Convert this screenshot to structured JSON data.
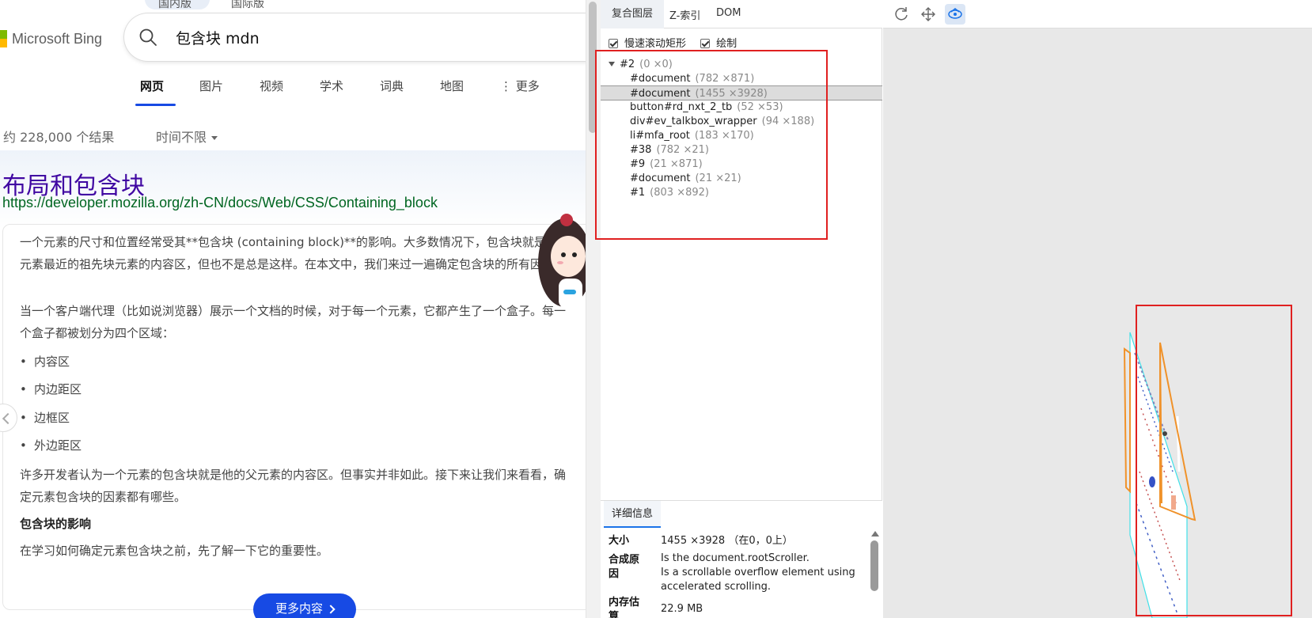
{
  "bing": {
    "top_tabs": [
      "国内版",
      "国际版"
    ],
    "logo_text": "Microsoft Bing",
    "query": "包含块 mdn",
    "tabs": [
      {
        "label": "网页"
      },
      {
        "label": "图片"
      },
      {
        "label": "视频"
      },
      {
        "label": "学术"
      },
      {
        "label": "词典"
      },
      {
        "label": "地图"
      },
      {
        "label": "⋮ 更多"
      }
    ],
    "result_count": "约 228,000 个结果",
    "time_filter": "时间不限",
    "result": {
      "title": "布局和包含块",
      "url": "https://developer.mozilla.org/zh-CN/docs/Web/CSS/Containing_block",
      "para1": "一个元素的尺寸和位置经常受其**包含块 (containing block)**的影响。大多数情况下，包含块就是这个元素最近的祖先块元素的内容区，但也不是总是这样。在本文中，我们来过一遍确定包含块的所有因素。",
      "para2": "当一个客户端代理（比如说浏览器）展示一个文档的时候，对于每一个元素，它都产生了一个盒子。每一个盒子都被划分为四个区域：",
      "bullets": [
        "内容区",
        "内边距区",
        "边框区",
        "外边距区"
      ],
      "para3": "许多开发者认为一个元素的包含块就是他的父元素的内容区。但事实并非如此。接下来让我们来看看，确定元素包含块的因素都有哪些。",
      "heading": "包含块的影响",
      "para4": "在学习如何确定元素包含块之前，先了解一下它的重要性。"
    },
    "more_button": "更多内容"
  },
  "layers": {
    "tabs": [
      "复合图层",
      "Z-索引",
      "DOM"
    ],
    "checkboxes": [
      {
        "label": "慢速滚动矩形",
        "checked": true
      },
      {
        "label": "绘制",
        "checked": true
      }
    ],
    "tree": [
      {
        "name": "#2",
        "dims": "(0 ×0)",
        "expanded": true,
        "indent": 0
      },
      {
        "name": "#document",
        "dims": "(782 ×871)",
        "indent": 1
      },
      {
        "name": "#document",
        "dims": "(1455 ×3928)",
        "indent": 1,
        "selected": true
      },
      {
        "name": "button#rd_nxt_2_tb",
        "dims": "(52 ×53)",
        "indent": 1
      },
      {
        "name": "div#ev_talkbox_wrapper",
        "dims": "(94 ×188)",
        "indent": 1
      },
      {
        "name": "li#mfa_root",
        "dims": "(183 ×170)",
        "indent": 1
      },
      {
        "name": "#38",
        "dims": "(782 ×21)",
        "indent": 1
      },
      {
        "name": "#9",
        "dims": "(21 ×871)",
        "indent": 1
      },
      {
        "name": "#document",
        "dims": "(21 ×21)",
        "indent": 1
      },
      {
        "name": "#1",
        "dims": "(803 ×892)",
        "indent": 1
      }
    ],
    "details": {
      "tab": "详细信息",
      "size_label": "大小",
      "size_value": "1455 ×3928 （在0，0上）",
      "reason_label": "合成原因",
      "reason_value_1": "Is the document.rootScroller.",
      "reason_value_2": "Is a scrollable overflow element using accelerated scrolling.",
      "memory_label": "内存估算",
      "memory_value": "22.9 MB"
    }
  },
  "view3d": {
    "tools": [
      "refresh-icon",
      "pan-icon",
      "rotate-icon"
    ],
    "active_tool": "rotate-icon"
  },
  "colors": {
    "bing_blue": "#174ae4",
    "title_purple": "#4007a2",
    "url_green": "#006621",
    "highlight_red": "#e02020",
    "layer_orange": "#f0922a",
    "layer_cyan": "#3fe0e8"
  }
}
